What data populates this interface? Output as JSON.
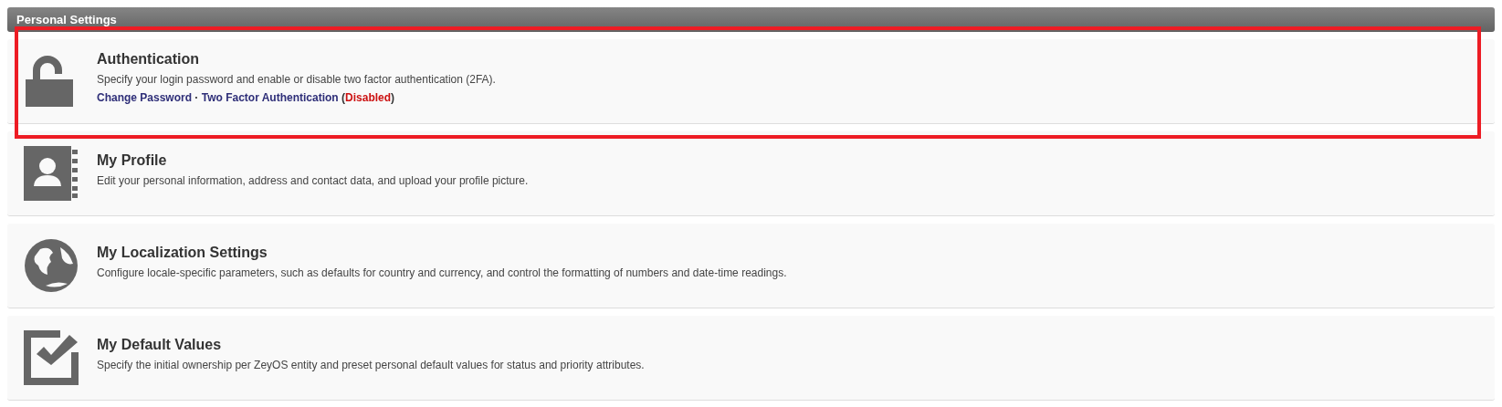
{
  "panel": {
    "title": "Personal Settings"
  },
  "items": [
    {
      "kind": "lock",
      "title": "Authentication",
      "description": "Specify your login password and enable or disable two factor authentication (2FA).",
      "highlighted": true,
      "links": [
        {
          "label": "Change Password"
        },
        {
          "label": "Two Factor Authentication",
          "status": {
            "open": "(",
            "label": "Disabled",
            "close": ")",
            "enabled": false
          }
        }
      ],
      "separator": "·"
    },
    {
      "kind": "profile",
      "title": "My Profile",
      "description": "Edit your personal information, address and contact data, and upload your profile picture.",
      "highlighted": false
    },
    {
      "kind": "globe",
      "title": "My Localization Settings",
      "description": "Configure locale-specific parameters, such as defaults for country and currency, and control the formatting of numbers and date-time readings.",
      "highlighted": false
    },
    {
      "kind": "check",
      "title": "My Default Values",
      "description": "Specify the initial ownership per ZeyOS entity and preset personal default values for status and priority attributes.",
      "highlighted": false
    }
  ]
}
